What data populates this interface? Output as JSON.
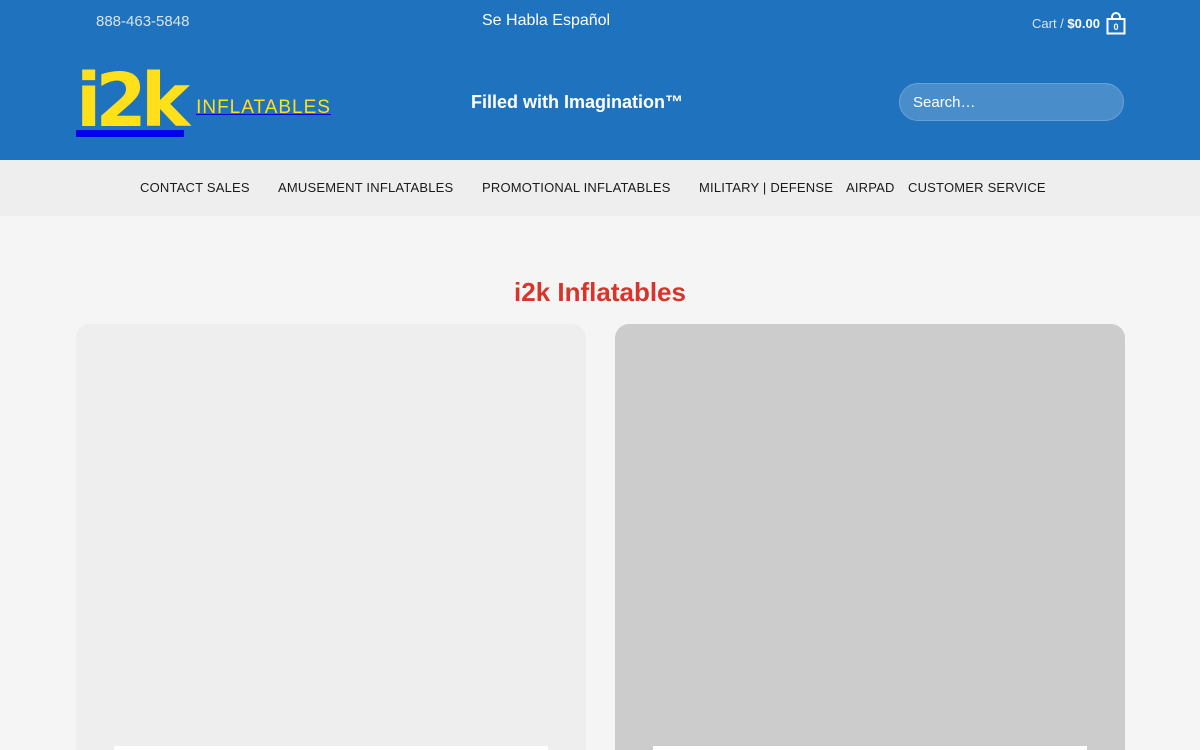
{
  "topbar": {
    "phone": "888-463-5848",
    "habla": "Se Habla Español",
    "cart_label": "Cart /",
    "cart_total": "$0.00",
    "cart_count": "0"
  },
  "branding": {
    "logo_mark": "i2k",
    "logo_word": "INFLATABLES",
    "tagline": "Filled with Imagination™"
  },
  "search": {
    "placeholder": "Search…"
  },
  "nav": {
    "items": [
      "CONTACT SALES",
      "AMUSEMENT INFLATABLES",
      "PROMOTIONAL INFLATABLES",
      "MILITARY | DEFENSE",
      "AIRPAD",
      "CUSTOMER SERVICE"
    ]
  },
  "main": {
    "heading": "i2k Inflatables"
  },
  "colors": {
    "header": "#1f72bd",
    "logo": "#ffe01b",
    "heading": "#d7352a",
    "nav_bg": "#eeeeee",
    "page_bg": "#f5f5f5"
  },
  "icons": {
    "cart": "shopping-bag-icon"
  }
}
